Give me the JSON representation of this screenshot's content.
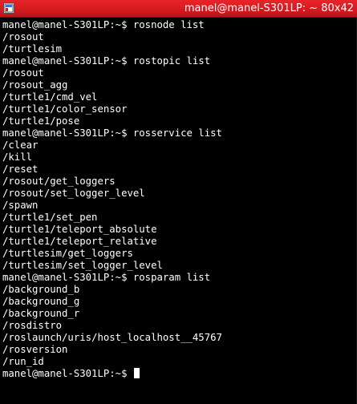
{
  "window": {
    "title": "manel@manel-S301LP: ~ 80x42",
    "colors": {
      "titlebar": "#d61b20",
      "terminal_bg": "#000000",
      "terminal_fg": "#ffffff"
    },
    "icon": "terminal-app-icon"
  },
  "terminal": {
    "prompt": "manel@manel-S301LP:~$ ",
    "lines": [
      "manel@manel-S301LP:~$ rosnode list",
      "/rosout",
      "/turtlesim",
      "manel@manel-S301LP:~$ rostopic list",
      "/rosout",
      "/rosout_agg",
      "/turtle1/cmd_vel",
      "/turtle1/color_sensor",
      "/turtle1/pose",
      "manel@manel-S301LP:~$ rosservice list",
      "/clear",
      "/kill",
      "/reset",
      "/rosout/get_loggers",
      "/rosout/set_logger_level",
      "/spawn",
      "/turtle1/set_pen",
      "/turtle1/teleport_absolute",
      "/turtle1/teleport_relative",
      "/turtlesim/get_loggers",
      "/turtlesim/set_logger_level",
      "manel@manel-S301LP:~$ rosparam list",
      "/background_b",
      "/background_g",
      "/background_r",
      "/rosdistro",
      "/roslaunch/uris/host_localhost__45767",
      "/rosversion",
      "/run_id"
    ]
  }
}
